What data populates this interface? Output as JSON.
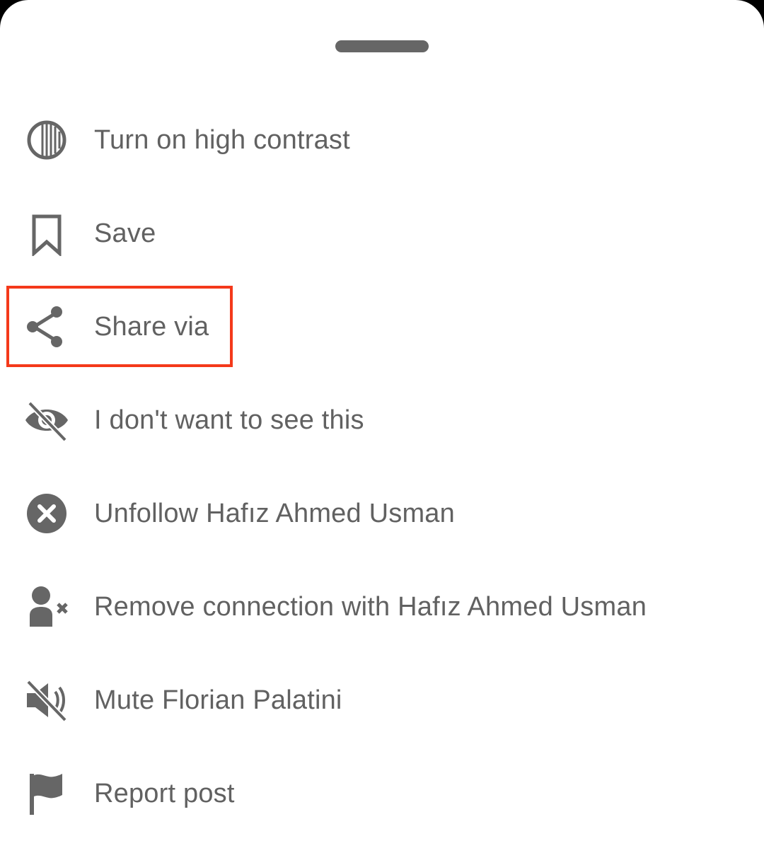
{
  "menu": {
    "items": [
      {
        "label": "Turn on high contrast",
        "icon": "high-contrast-icon"
      },
      {
        "label": "Save",
        "icon": "bookmark-icon"
      },
      {
        "label": "Share via",
        "icon": "share-icon"
      },
      {
        "label": "I don't want to see this",
        "icon": "eye-off-icon"
      },
      {
        "label": "Unfollow Hafız Ahmed Usman",
        "icon": "close-circle-icon"
      },
      {
        "label": "Remove connection with Hafız Ahmed Usman",
        "icon": "remove-person-icon"
      },
      {
        "label": "Mute Florian Palatini",
        "icon": "mute-icon"
      },
      {
        "label": "Report post",
        "icon": "flag-icon"
      }
    ]
  },
  "colors": {
    "text": "#616161",
    "icon": "#666666",
    "highlight": "#f4391a",
    "background": "#ffffff"
  }
}
